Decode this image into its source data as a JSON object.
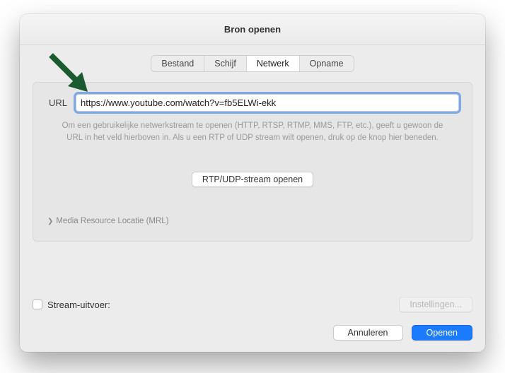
{
  "window": {
    "title": "Bron openen"
  },
  "tabs": {
    "items": [
      {
        "label": "Bestand",
        "active": false
      },
      {
        "label": "Schijf",
        "active": false
      },
      {
        "label": "Netwerk",
        "active": true
      },
      {
        "label": "Opname",
        "active": false
      }
    ]
  },
  "url": {
    "label": "URL",
    "value": "https://www.youtube.com/watch?v=fb5ELWi-ekk"
  },
  "help_text": "Om een gebruikelijke netwerkstream te openen (HTTP, RTSP, RTMP, MMS, FTP, etc.), geeft u gewoon de URL in het veld hierboven in. Als u een RTP of UDP stream wilt openen, druk op de knop hier beneden.",
  "rtp_button": "RTP/UDP-stream openen",
  "disclosure": {
    "label": "Media Resource Locatie (MRL)"
  },
  "stream_output": {
    "label": "Stream-uitvoer:",
    "settings_button": "Instellingen..."
  },
  "actions": {
    "cancel": "Annuleren",
    "open": "Openen"
  },
  "colors": {
    "accent": "#1a7bff",
    "arrow": "#1c5a2f"
  }
}
